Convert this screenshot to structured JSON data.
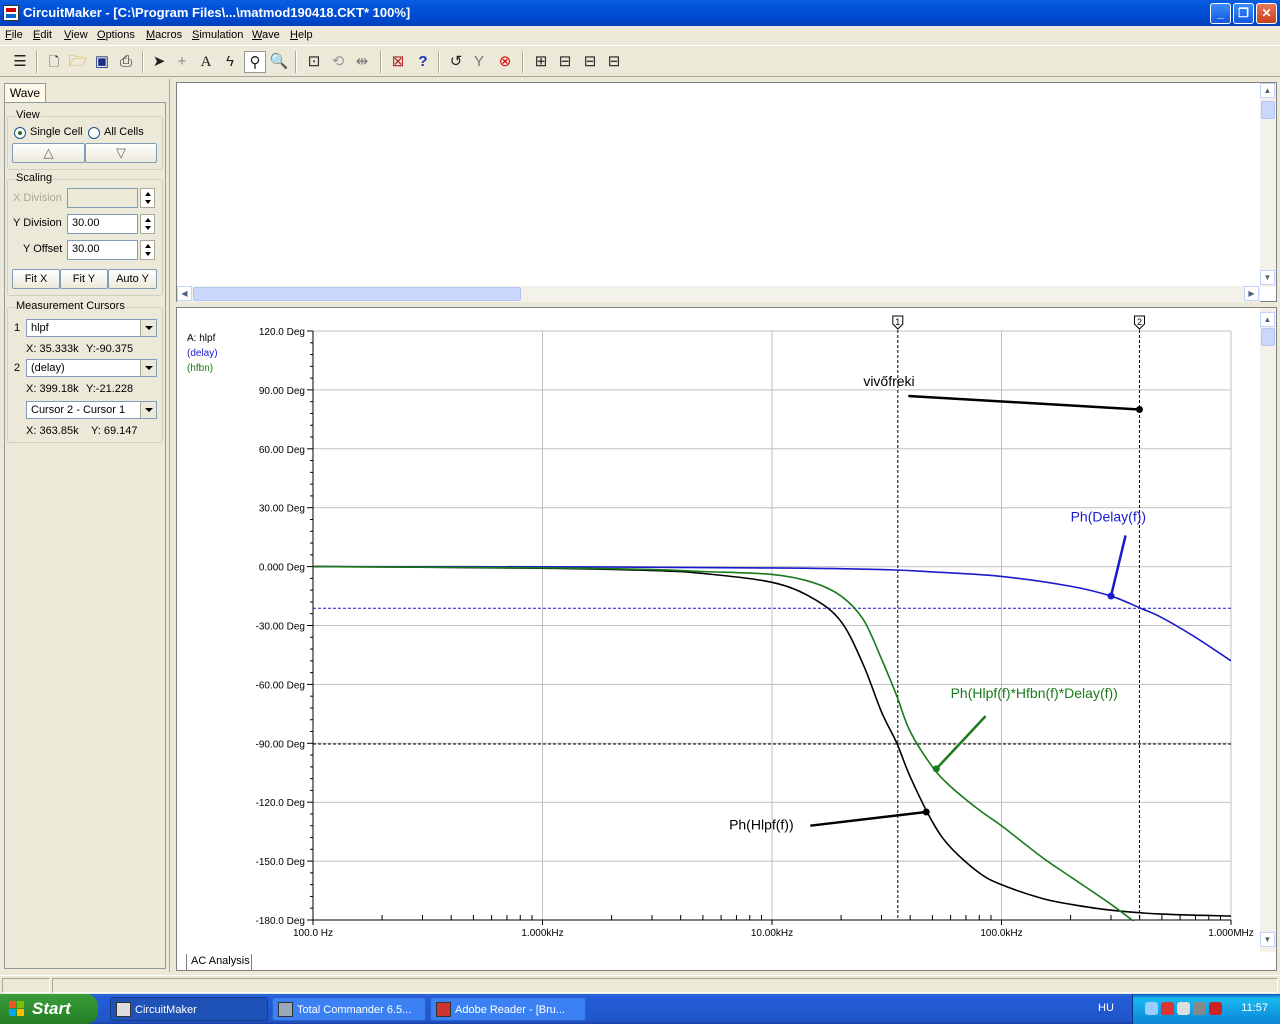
{
  "window": {
    "title": "CircuitMaker - [C:\\Program Files\\...\\matmod190418.CKT* 100%]"
  },
  "menu": [
    "File",
    "Edit",
    "View",
    "Options",
    "Macros",
    "Simulation",
    "Wave",
    "Help"
  ],
  "toolbar": {
    "icons": [
      "arrange-icon",
      "new-file-icon",
      "open-file-icon",
      "save-icon",
      "print-icon",
      "arrow-icon",
      "wire-icon",
      "text-icon",
      "probe-icon",
      "probe-tool-icon",
      "zoom-icon",
      "zoom-window-icon",
      "rotate-icon",
      "mirror-icon",
      "parts-icon",
      "help-icon",
      "undo-icon",
      "digital-probe-icon",
      "stop-icon",
      "wave-new-icon",
      "wave-view1-icon",
      "wave-view2-icon",
      "wave-view3-icon"
    ]
  },
  "panel": {
    "tab": "Wave",
    "view": {
      "label": "View",
      "single": "Single Cell",
      "all": "All Cells",
      "up": "△",
      "down": "▽"
    },
    "scaling": {
      "label": "Scaling",
      "xdiv_label": "X Division",
      "xdiv_value": "",
      "ydiv_label": "Y Division",
      "ydiv_value": "30.00",
      "yoff_label": "Y Offset",
      "yoff_value": "30.00",
      "fitx": "Fit X",
      "fity": "Fit Y",
      "autoy": "Auto Y"
    },
    "cursors": {
      "label": "Measurement Cursors",
      "c1_num": "1",
      "c1_name": "hlpf",
      "c1_x": "X: 35.333k",
      "c1_y": "Y:-90.375",
      "c2_num": "2",
      "c2_name": "(delay)",
      "c2_x": "X: 399.18k",
      "c2_y": "Y:-21.228",
      "diff_name": "Cursor 2 - Cursor 1",
      "diff_x": "X: 363.85k",
      "diff_y": "Y: 69.147"
    }
  },
  "tabs": {
    "ac": "AC Analysis"
  },
  "chart_data": {
    "type": "line",
    "title": "",
    "xlabel": "",
    "ylabel": "",
    "xscale": "log",
    "xlim": [
      100,
      1000000
    ],
    "ylim": [
      -180,
      120
    ],
    "grid": true,
    "xtick_values": [
      100,
      1000,
      10000,
      100000,
      1000000
    ],
    "xtick_labels": [
      "100.0 Hz",
      "1.000kHz",
      "10.00kHz",
      "100.0kHz",
      "1.000MHz"
    ],
    "ytick_values": [
      120,
      90,
      60,
      30,
      0,
      -30,
      -60,
      -90,
      -120,
      -150,
      -180
    ],
    "ytick_labels": [
      "120.0 Deg",
      "90.00 Deg",
      "60.00 Deg",
      "30.00 Deg",
      "0.000 Deg",
      "-30.00 Deg",
      "-60.00 Deg",
      "-90.00 Deg",
      "-120.0 Deg",
      "-150.0 Deg",
      "-180.0 Deg"
    ],
    "legend": [
      "A: hlpf",
      "(delay)",
      "(hfbn)"
    ],
    "series": [
      {
        "name": "A: hlpf",
        "color": "#000000",
        "x": [
          100,
          1000,
          3000,
          5000,
          10000,
          15000,
          20000,
          25000,
          30000,
          35000,
          40000,
          50000,
          60000,
          80000,
          100000,
          150000,
          200000,
          300000,
          500000,
          1000000
        ],
        "y": [
          0,
          -0.8,
          -2,
          -3.5,
          -8,
          -16,
          -28,
          -50,
          -74,
          -90,
          -107,
          -130,
          -143,
          -156,
          -162,
          -169,
          -172,
          -175,
          -177,
          -178
        ]
      },
      {
        "name": "(delay)",
        "color": "#1a1acc",
        "x": [
          100,
          1000,
          10000,
          30000,
          50000,
          100000,
          200000,
          300000,
          400000,
          500000,
          700000,
          1000000
        ],
        "y": [
          0,
          -0.1,
          -0.7,
          -1.5,
          -2.7,
          -5,
          -10,
          -15,
          -21,
          -26,
          -36,
          -48
        ]
      },
      {
        "name": "(hfbn)",
        "color": "#1a7a1a",
        "x": [
          100,
          1000,
          3000,
          5000,
          10000,
          15000,
          20000,
          25000,
          30000,
          35000,
          40000,
          50000,
          60000,
          80000,
          100000,
          150000,
          200000,
          300000,
          400000
        ],
        "y": [
          0,
          -0.6,
          -1.5,
          -2.5,
          -4,
          -8,
          -15,
          -27,
          -47,
          -66,
          -84,
          -102,
          -112,
          -124,
          -132,
          -148,
          -158,
          -172,
          -183
        ]
      }
    ],
    "cursors": [
      {
        "label": "1",
        "x": 35333,
        "y": -90.375
      },
      {
        "label": "2",
        "x": 399180,
        "y": -21.228
      }
    ],
    "annotations": [
      {
        "text": "vivőfreki",
        "color": "#000000",
        "tx": 25000,
        "ty": 92,
        "ax": 399180,
        "ay": 80
      },
      {
        "text": "Ph(Delay(f))",
        "color": "#1a1acc",
        "tx": 200000,
        "ty": 23,
        "ax": 300000,
        "ay": -15
      },
      {
        "text": "Ph(Hlpf(f)*Hfbn(f)*Delay(f))",
        "color": "#1a7a1a",
        "tx": 60000,
        "ty": -67,
        "ax": 52000,
        "ay": -103
      },
      {
        "text": "Ph(Hlpf(f))",
        "color": "#000000",
        "tx": 6500,
        "ty": -134,
        "ax": 47000,
        "ay": -125
      }
    ]
  },
  "taskbar": {
    "start": "Start",
    "tasks": [
      "CircuitMaker",
      "Total Commander 6.5...",
      "Adobe Reader - [Bru..."
    ],
    "lang": "HU",
    "clock": "11:57"
  }
}
